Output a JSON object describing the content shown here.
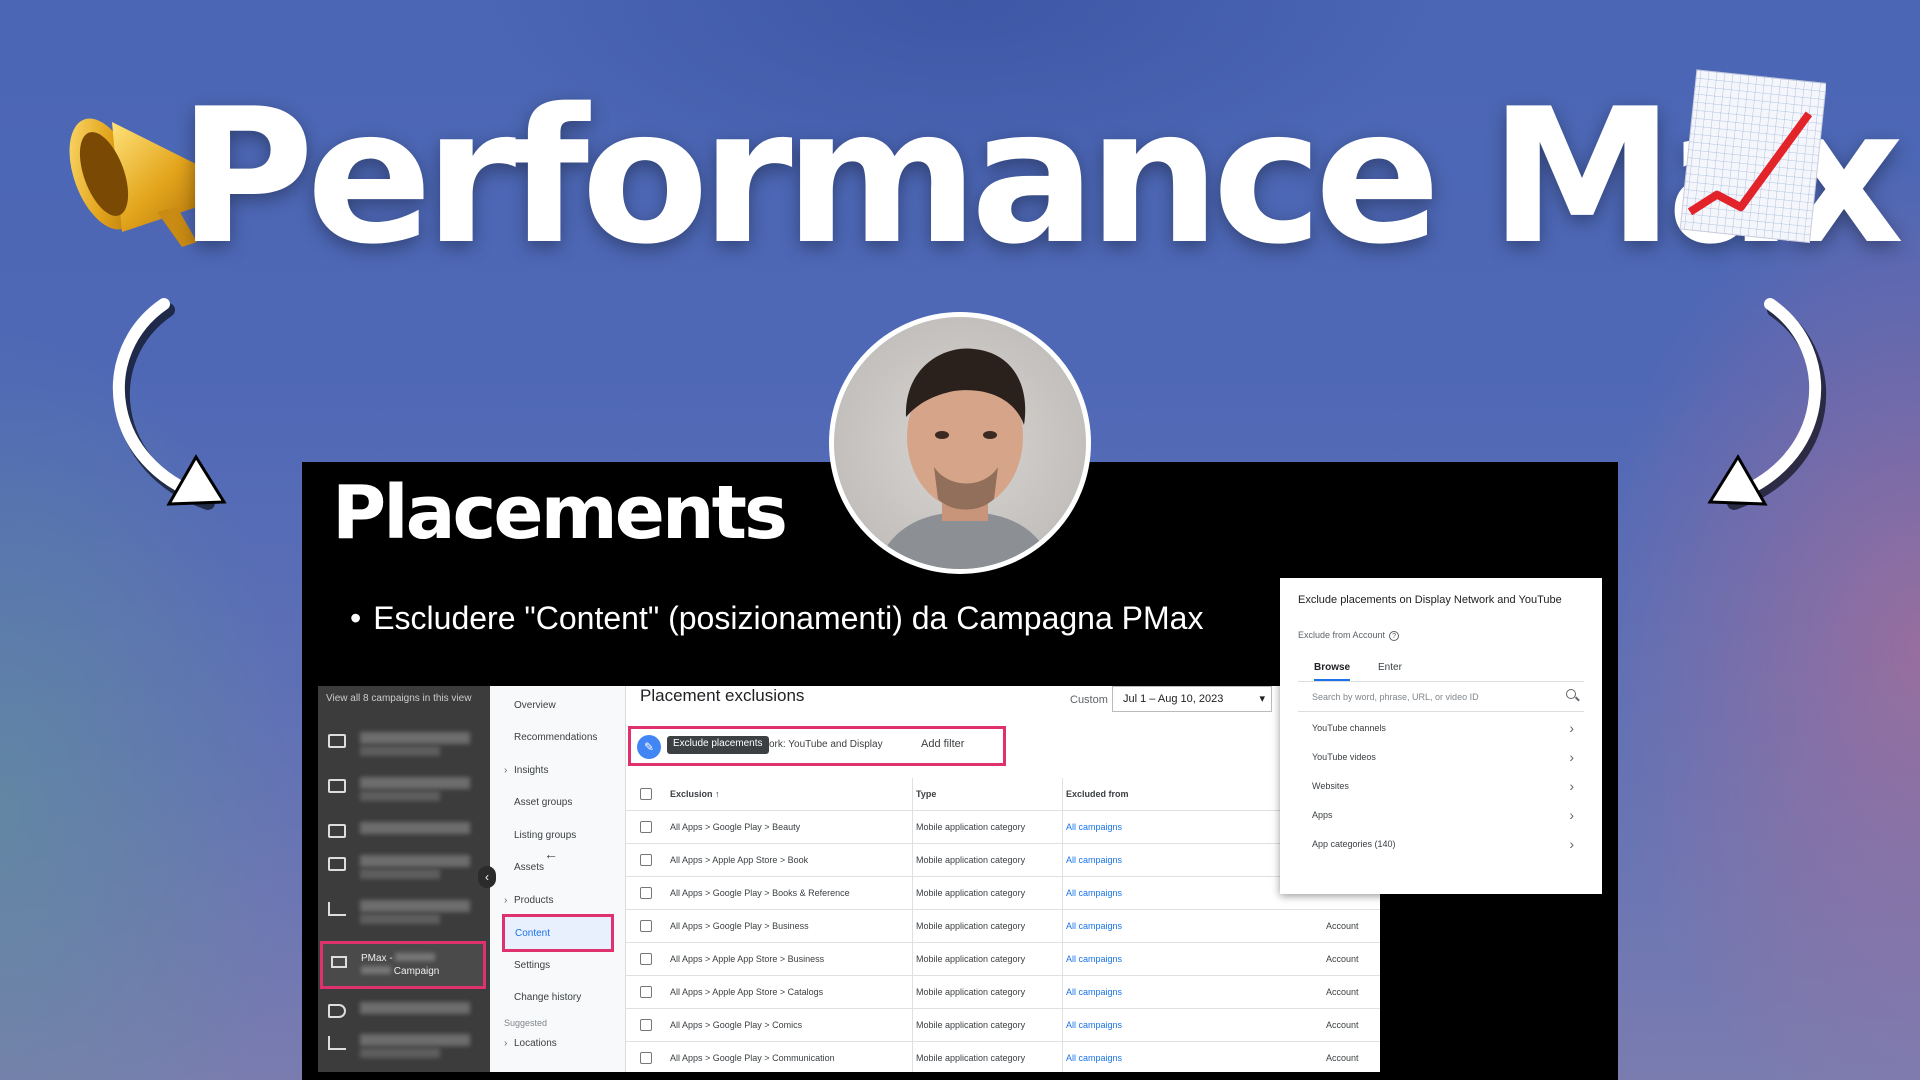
{
  "hero": {
    "title": "Performance Max"
  },
  "slide": {
    "title": "Placements",
    "bullet": "Escludere \"Content\" (posizionamenti) da Campagna PMax"
  },
  "campaign_rail": {
    "header": "View all 8 campaigns in this view",
    "pmax_label_start": "PMax -",
    "pmax_label_end": "Campaign"
  },
  "nav": {
    "items": [
      "Overview",
      "Recommendations",
      "Insights",
      "Asset groups",
      "Listing groups",
      "Assets",
      "Products",
      "Content",
      "Settings",
      "Change history",
      "Suggested",
      "Locations"
    ]
  },
  "main": {
    "title": "Placement exclusions",
    "custom_label": "Custom",
    "date_range": "Jul 1 – Aug 10, 2023",
    "tooltip": "Exclude placements",
    "network_filter": "ork: YouTube and Display",
    "add_filter": "Add filter",
    "columns": [
      "Exclusion",
      "Type",
      "Excluded from"
    ],
    "rows": [
      {
        "exclusion": "All Apps > Google Play > Beauty",
        "type": "Mobile application category",
        "from": "All campaigns",
        "level": ""
      },
      {
        "exclusion": "All Apps > Apple App Store > Book",
        "type": "Mobile application category",
        "from": "All campaigns",
        "level": ""
      },
      {
        "exclusion": "All Apps > Google Play > Books & Reference",
        "type": "Mobile application category",
        "from": "All campaigns",
        "level": ""
      },
      {
        "exclusion": "All Apps > Google Play > Business",
        "type": "Mobile application category",
        "from": "All campaigns",
        "level": "Account"
      },
      {
        "exclusion": "All Apps > Apple App Store > Business",
        "type": "Mobile application category",
        "from": "All campaigns",
        "level": "Account"
      },
      {
        "exclusion": "All Apps > Apple App Store > Catalogs",
        "type": "Mobile application category",
        "from": "All campaigns",
        "level": "Account"
      },
      {
        "exclusion": "All Apps > Google Play > Comics",
        "type": "Mobile application category",
        "from": "All campaigns",
        "level": "Account"
      },
      {
        "exclusion": "All Apps > Google Play > Communication",
        "type": "Mobile application category",
        "from": "All campaigns",
        "level": "Account"
      }
    ]
  },
  "panel": {
    "title": "Exclude placements on Display Network and YouTube",
    "subtitle": "Exclude from Account",
    "tabs": [
      "Browse",
      "Enter"
    ],
    "search_placeholder": "Search by word, phrase, URL, or video ID",
    "items": [
      "YouTube channels",
      "YouTube videos",
      "Websites",
      "Apps",
      "App categories (140)"
    ]
  },
  "colors": {
    "highlight": "#e0316f",
    "link": "#1a73e8",
    "background": "#4f68b6"
  }
}
